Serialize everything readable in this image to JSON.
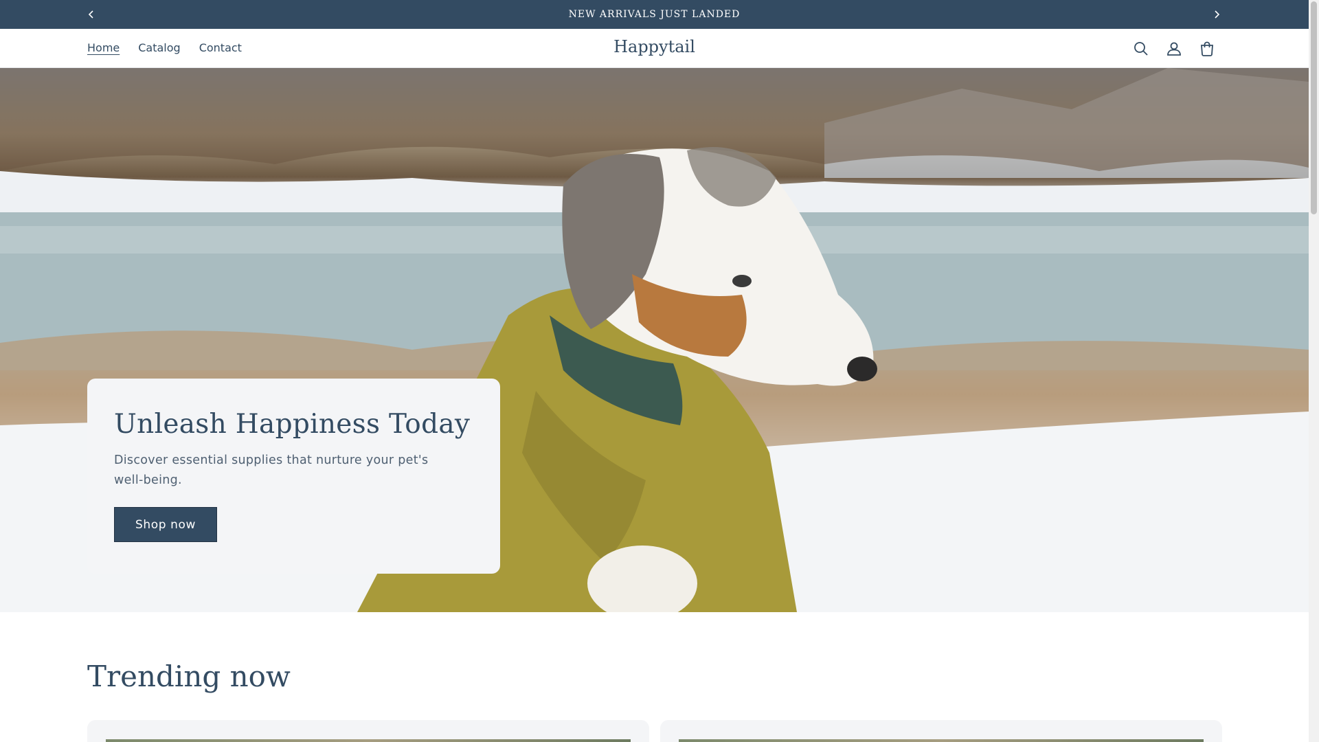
{
  "announcement": {
    "text": "NEW ARRIVALS JUST LANDED",
    "prev_icon": "chevron-left-icon",
    "next_icon": "chevron-right-icon"
  },
  "header": {
    "nav": [
      {
        "label": "Home",
        "active": true
      },
      {
        "label": "Catalog",
        "active": false
      },
      {
        "label": "Contact",
        "active": false
      }
    ],
    "logo": "Happytail",
    "icons": [
      "search-icon",
      "account-icon",
      "cart-icon"
    ]
  },
  "hero": {
    "image": "dog-in-yellow-jacket-by-snowy-lake",
    "title": "Unleash Happiness Today",
    "subtitle": "Discover essential supplies that nurture your pet's well-being.",
    "button_label": "Shop now"
  },
  "trending": {
    "title": "Trending now"
  },
  "colors": {
    "primary": "#334b62",
    "card_bg": "#f4f5f7",
    "text_muted": "#4e5f71"
  }
}
